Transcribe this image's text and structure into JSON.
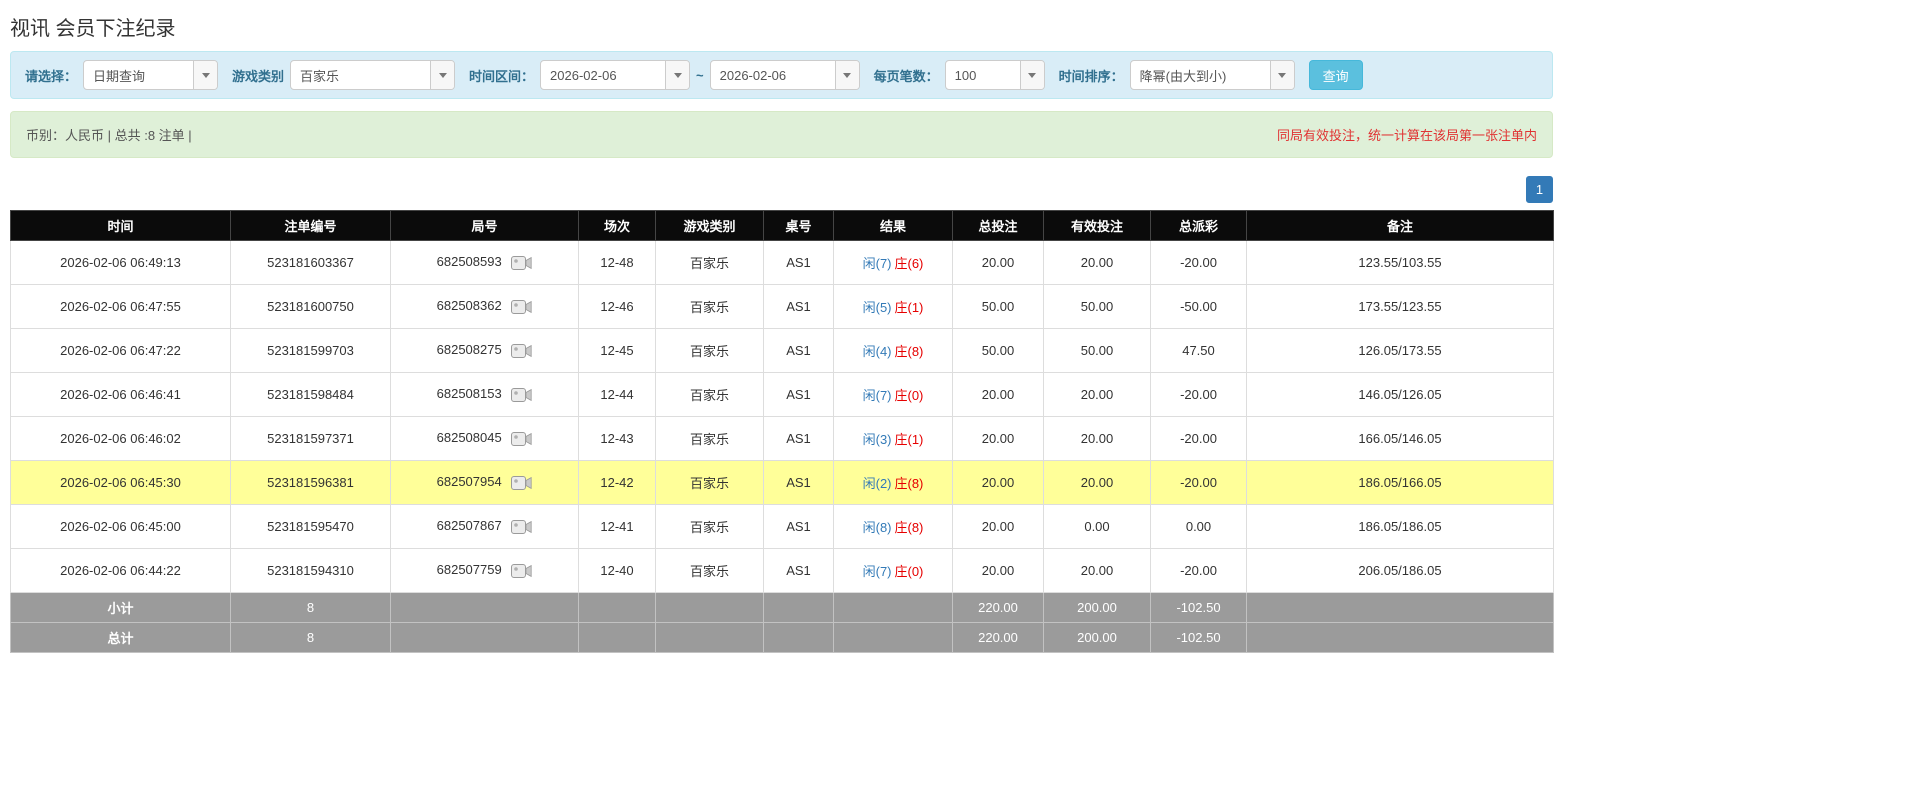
{
  "page": {
    "title": "视讯 会员下注纪录"
  },
  "filter_bar": {
    "select_label": "请选择：",
    "select_value": "日期查询",
    "game_type_label": "游戏类别",
    "game_type_value": "百家乐",
    "time_range_label": "时间区间：",
    "date_from": "2026-02-06",
    "range_separator": "~",
    "date_to": "2026-02-06",
    "per_page_label": "每页笔数：",
    "per_page_value": "100",
    "sort_label": "时间排序：",
    "sort_value": "降幂(由大到小)",
    "search_button_label": "查询"
  },
  "summary_bar": {
    "left_text": "币别：人民币 | 总共 :8 注单 |",
    "right_text": "同局有效投注，统一计算在该局第一张注单内"
  },
  "pagination": {
    "current_page": "1"
  },
  "table": {
    "headers": [
      "时间",
      "注单编号",
      "局号",
      "场次",
      "游戏类别",
      "桌号",
      "结果",
      "总投注",
      "有效投注",
      "总派彩",
      "备注"
    ],
    "rows": [
      {
        "time": "2026-02-06 06:49:13",
        "bet_id": "523181603367",
        "round_no": "682508593",
        "session": "12-48",
        "game_type": "百家乐",
        "table_no": "AS1",
        "result_player": "闲(7)",
        "result_banker": "庄(6)",
        "total_bet": "20.00",
        "valid_bet": "20.00",
        "payout": "-20.00",
        "note": "123.55/103.55",
        "highlight": false
      },
      {
        "time": "2026-02-06 06:47:55",
        "bet_id": "523181600750",
        "round_no": "682508362",
        "session": "12-46",
        "game_type": "百家乐",
        "table_no": "AS1",
        "result_player": "闲(5)",
        "result_banker": "庄(1)",
        "total_bet": "50.00",
        "valid_bet": "50.00",
        "payout": "-50.00",
        "note": "173.55/123.55",
        "highlight": false
      },
      {
        "time": "2026-02-06 06:47:22",
        "bet_id": "523181599703",
        "round_no": "682508275",
        "session": "12-45",
        "game_type": "百家乐",
        "table_no": "AS1",
        "result_player": "闲(4)",
        "result_banker": "庄(8)",
        "total_bet": "50.00",
        "valid_bet": "50.00",
        "payout": "47.50",
        "note": "126.05/173.55",
        "highlight": false
      },
      {
        "time": "2026-02-06 06:46:41",
        "bet_id": "523181598484",
        "round_no": "682508153",
        "session": "12-44",
        "game_type": "百家乐",
        "table_no": "AS1",
        "result_player": "闲(7)",
        "result_banker": "庄(0)",
        "total_bet": "20.00",
        "valid_bet": "20.00",
        "payout": "-20.00",
        "note": "146.05/126.05",
        "highlight": false
      },
      {
        "time": "2026-02-06 06:46:02",
        "bet_id": "523181597371",
        "round_no": "682508045",
        "session": "12-43",
        "game_type": "百家乐",
        "table_no": "AS1",
        "result_player": "闲(3)",
        "result_banker": "庄(1)",
        "total_bet": "20.00",
        "valid_bet": "20.00",
        "payout": "-20.00",
        "note": "166.05/146.05",
        "highlight": false
      },
      {
        "time": "2026-02-06 06:45:30",
        "bet_id": "523181596381",
        "round_no": "682507954",
        "session": "12-42",
        "game_type": "百家乐",
        "table_no": "AS1",
        "result_player": "闲(2)",
        "result_banker": "庄(8)",
        "total_bet": "20.00",
        "valid_bet": "20.00",
        "payout": "-20.00",
        "note": "186.05/166.05",
        "highlight": true
      },
      {
        "time": "2026-02-06 06:45:00",
        "bet_id": "523181595470",
        "round_no": "682507867",
        "session": "12-41",
        "game_type": "百家乐",
        "table_no": "AS1",
        "result_player": "闲(8)",
        "result_banker": "庄(8)",
        "total_bet": "20.00",
        "valid_bet": "0.00",
        "payout": "0.00",
        "note": "186.05/186.05",
        "highlight": false
      },
      {
        "time": "2026-02-06 06:44:22",
        "bet_id": "523181594310",
        "round_no": "682507759",
        "session": "12-40",
        "game_type": "百家乐",
        "table_no": "AS1",
        "result_player": "闲(7)",
        "result_banker": "庄(0)",
        "total_bet": "20.00",
        "valid_bet": "20.00",
        "payout": "-20.00",
        "note": "206.05/186.05",
        "highlight": false
      }
    ],
    "subtotal_row": {
      "label": "小计",
      "count": "8",
      "total_bet": "220.00",
      "valid_bet": "200.00",
      "payout": "-102.50"
    },
    "total_row": {
      "label": "总计",
      "count": "8",
      "total_bet": "220.00",
      "valid_bet": "200.00",
      "payout": "-102.50"
    }
  },
  "icons": {
    "combo_caret": "chevron-down-icon",
    "round_replay": "video-replay-icon"
  },
  "colors": {
    "accent_blue": "#337ab7",
    "filter_bg": "#d9edf7",
    "summary_bg": "#dff0d8",
    "negative_red": "#e60000",
    "alert_red": "#e03333",
    "highlight_yellow": "#ffff99",
    "table_header_bg": "#0b0b0b",
    "table_footer_bg": "#9b9b9b",
    "search_button_bg": "#5bc0de"
  }
}
